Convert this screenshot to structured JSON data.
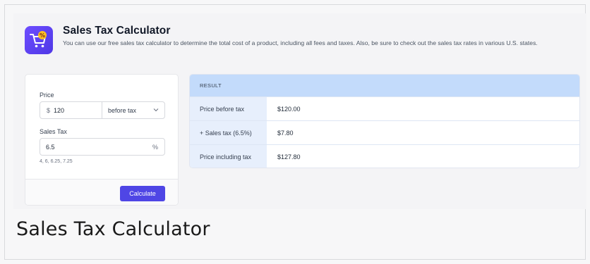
{
  "app": {
    "title": "Sales Tax Calculator",
    "description": "You can use our free sales tax calculator to determine the total cost of a product, including all fees and taxes. Also, be sure to check out the sales tax rates in various U.S. states.",
    "accent_color": "#4f46e5",
    "logo_icon": "shopping-cart-percent-icon"
  },
  "form": {
    "price_label": "Price",
    "currency_symbol": "$",
    "price_value": "120",
    "price_mode": "before tax",
    "sales_tax_label": "Sales Tax",
    "sales_tax_value": "6.5",
    "percent_symbol": "%",
    "rate_hints": "4, 6, 6.25, 7.25",
    "calculate_label": "Calculate"
  },
  "result": {
    "header": "RESULT",
    "header_color": "#c3dbfb",
    "rows": [
      {
        "label": "Price before tax",
        "value": "$120.00"
      },
      {
        "label": "+ Sales tax (6.5%)",
        "value": "$7.80"
      },
      {
        "label": "Price including tax",
        "value": "$127.80"
      }
    ]
  },
  "caption": "Sales Tax Calculator"
}
